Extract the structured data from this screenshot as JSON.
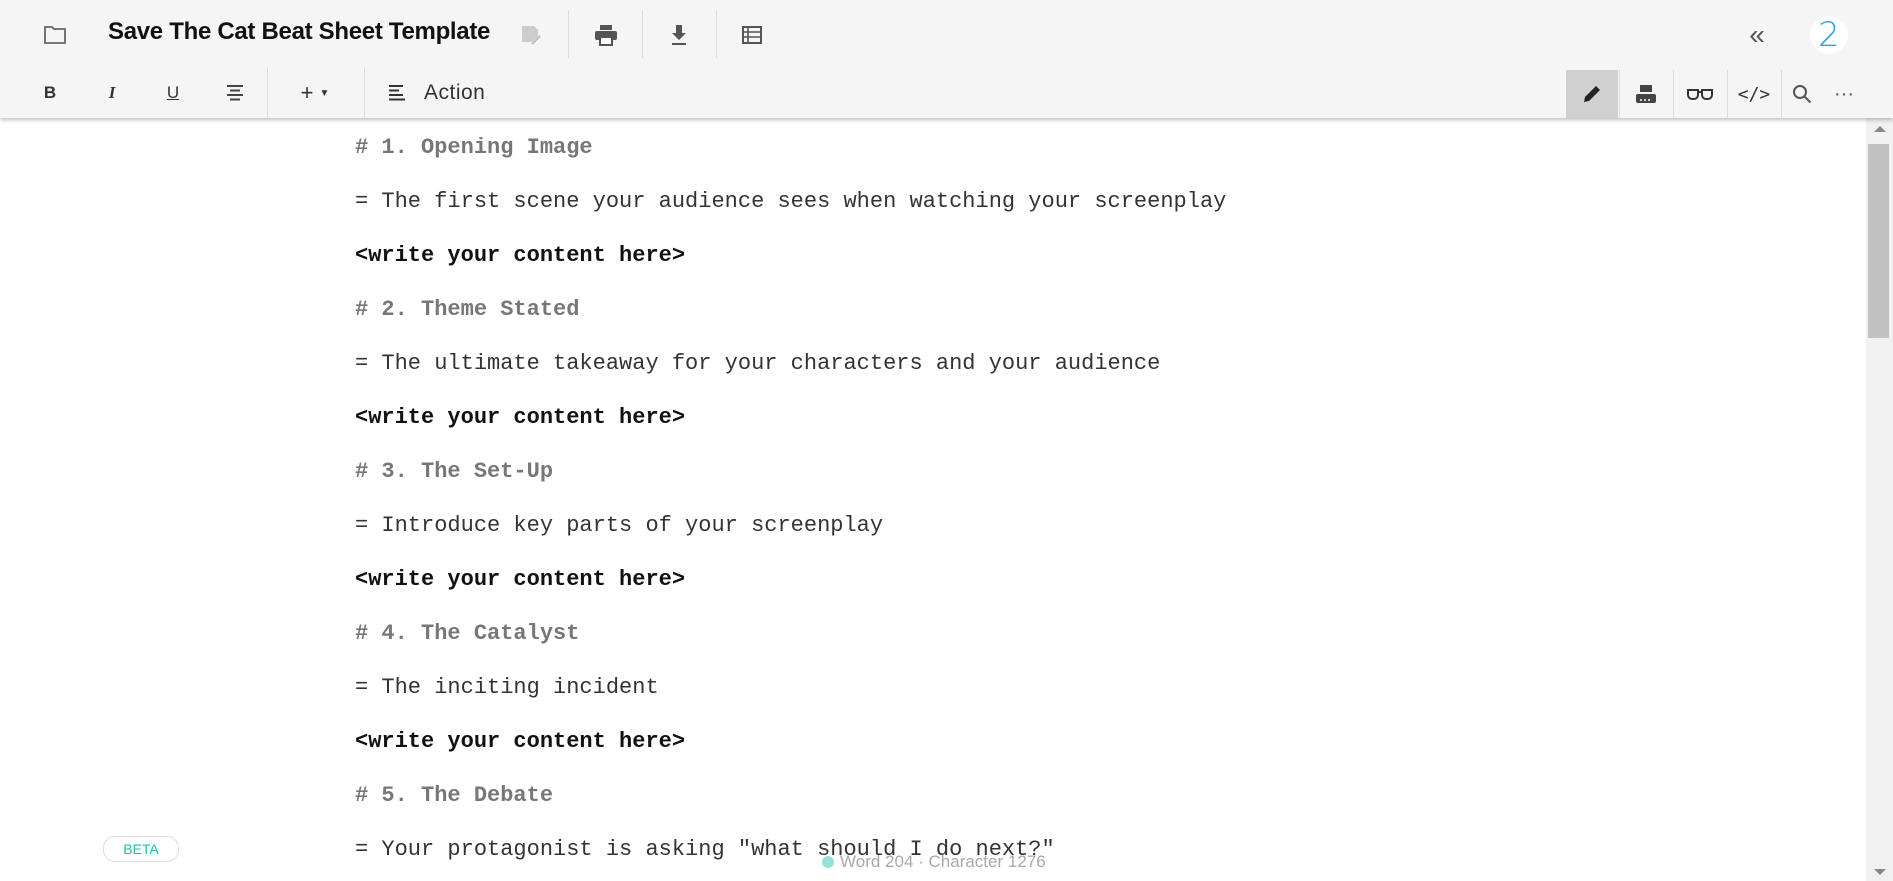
{
  "header": {
    "title": "Save The Cat Beat Sheet Template",
    "icons": [
      "folder-icon",
      "save-draft-icon",
      "print-icon",
      "download-icon",
      "outline-icon",
      "collapse-icon"
    ],
    "avatar_label": "2",
    "avatar_color": "#29a3dc"
  },
  "toolbar": {
    "bold_label": "B",
    "italic_label": "I",
    "underline_label": "U",
    "insert_label": "+",
    "element_type": "Action",
    "modes": [
      "edit",
      "typewriter",
      "preview",
      "code",
      "search",
      "more"
    ],
    "active_mode": "edit"
  },
  "document": {
    "lines": [
      {
        "type": "heading",
        "text": "# 1. Opening Image"
      },
      {
        "type": "desc",
        "text": "= The first scene your audience sees when watching your screenplay"
      },
      {
        "type": "content",
        "text": "<write your content here>"
      },
      {
        "type": "heading",
        "text": "# 2. Theme Stated"
      },
      {
        "type": "desc",
        "text": "= The ultimate takeaway for your characters and your audience"
      },
      {
        "type": "content",
        "text": "<write your content here>"
      },
      {
        "type": "heading",
        "text": "# 3. The Set-Up"
      },
      {
        "type": "desc",
        "text": "= Introduce key parts of your screenplay"
      },
      {
        "type": "content",
        "text": "<write your content here>"
      },
      {
        "type": "heading",
        "text": "# 4. The Catalyst"
      },
      {
        "type": "desc",
        "text": "= The inciting incident"
      },
      {
        "type": "content",
        "text": "<write your content here>"
      },
      {
        "type": "heading",
        "text": "# 5. The Debate"
      },
      {
        "type": "desc",
        "text": "= Your protagonist is asking \"what should I do next?\""
      }
    ]
  },
  "footer": {
    "beta_label": "BETA",
    "beta_color": "#1cc3a5",
    "status": "Word 204 · Character 1276"
  }
}
